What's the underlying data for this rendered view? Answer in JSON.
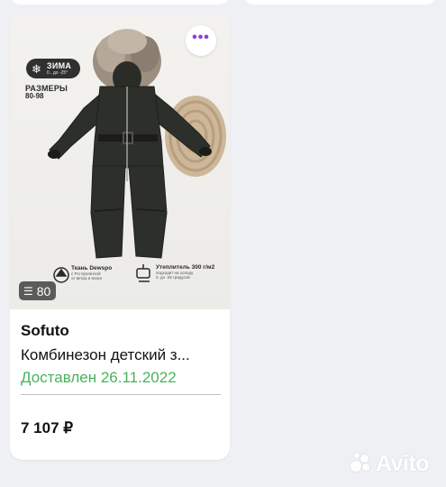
{
  "listing": {
    "brand": "Sofuto",
    "title": "Комбинезон детский з...",
    "status": "Доставлен 26.11.2022",
    "price": "7 107 ₽",
    "photo_count": "80",
    "more_label": "•••"
  },
  "photo_overlay": {
    "season_label": "ЗИМА",
    "season_temp": "0.. до -25°",
    "sizes_label": "РАЗМЕРЫ",
    "sizes_range": "80-98",
    "fabric_label": "Ткань Dewspo",
    "fabric_note_1": "с PU пропиткой",
    "fabric_note_2": "от ветра и влаги",
    "insulation_label": "Утеплитель 300 г/м2",
    "insulation_note_1": "подходит на холоду",
    "insulation_note_2": "0..до -25 градусов"
  },
  "watermark": {
    "logo_text": "Avito"
  },
  "icons": {
    "more": "more-horizontal-icon",
    "photos": "photo-stack-icon",
    "season": "snowflake-icon"
  },
  "colors": {
    "accent": "#8a3ddb",
    "status_green": "#47b35a",
    "background": "#eef0f3"
  }
}
